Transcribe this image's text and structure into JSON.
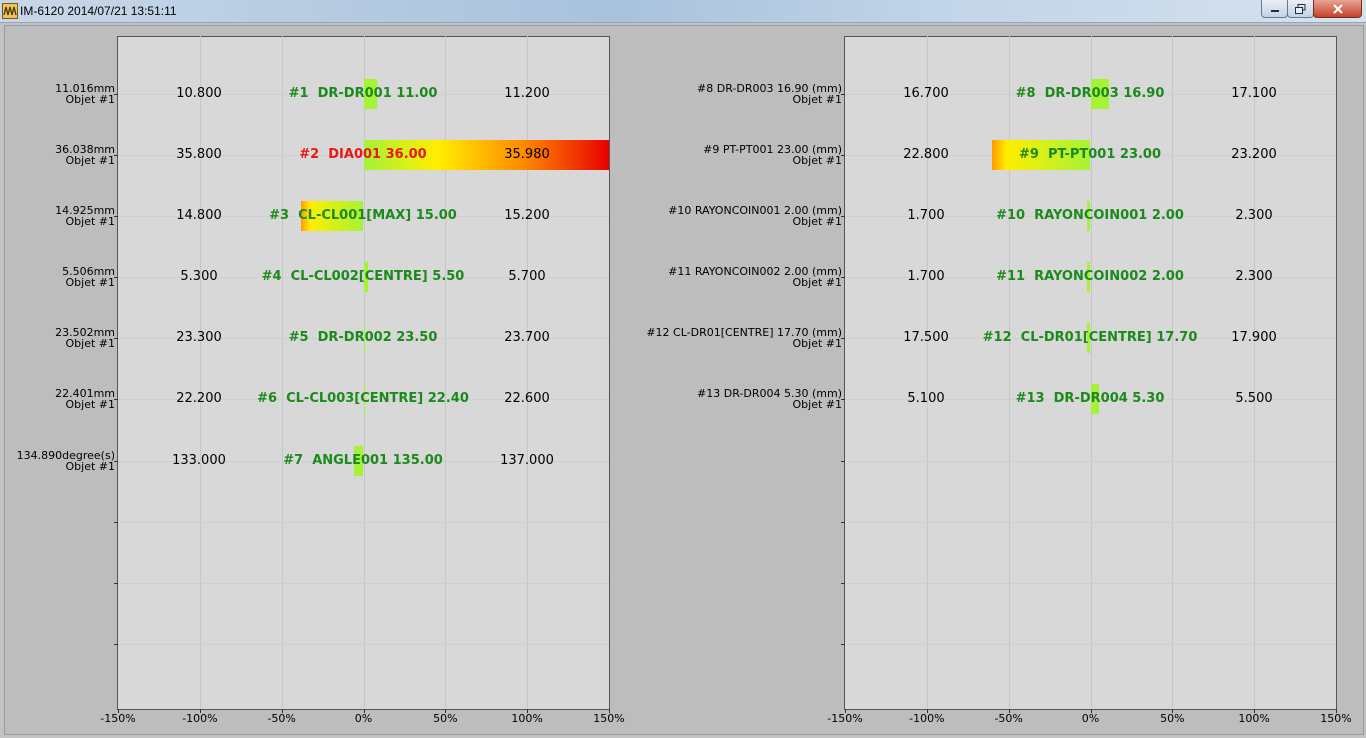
{
  "window": {
    "title": "IM-6120 2014/07/21 13:51:11",
    "app_icon": "waveform-icon",
    "controls": [
      "minimize-icon",
      "maximize-icon",
      "close-icon"
    ]
  },
  "colors": {
    "ok": "#1a8a1a",
    "ng": "#e81818",
    "bar_green": "#a6f237",
    "bar_yellow": "#ffee00",
    "bar_red": "#e80000",
    "panel_bg": "#d8d8d8"
  },
  "axis_labels": [
    "-150%",
    "-100%",
    "-50%",
    "0%",
    "50%",
    "100%",
    "150%"
  ],
  "left_panel": {
    "rows": [
      {
        "value": "11.016mm",
        "sub": "Objet #1",
        "min": "10.800",
        "name": "#1  DR-DR001 11.00",
        "max": "11.200",
        "deviation_pct": 8,
        "ng": false
      },
      {
        "value": "36.038mm",
        "sub": "Objet #1",
        "min": "35.800",
        "name": "#2  DIA001 36.00",
        "max": "35.980",
        "deviation_pct": 150,
        "ng": true
      },
      {
        "value": "14.925mm",
        "sub": "Objet #1",
        "min": "14.800",
        "name": "#3  CL-CL001[MAX] 15.00",
        "max": "15.200",
        "deviation_pct": -38,
        "ng": false
      },
      {
        "value": "5.506mm",
        "sub": "Objet #1",
        "min": "5.300",
        "name": "#4  CL-CL002[CENTRE] 5.50",
        "max": "5.700",
        "deviation_pct": 3,
        "ng": false
      },
      {
        "value": "23.502mm",
        "sub": "Objet #1",
        "min": "23.300",
        "name": "#5  DR-DR002 23.50",
        "max": "23.700",
        "deviation_pct": 1,
        "ng": false
      },
      {
        "value": "22.401mm",
        "sub": "Objet #1",
        "min": "22.200",
        "name": "#6  CL-CL003[CENTRE] 22.40",
        "max": "22.600",
        "deviation_pct": 0.5,
        "ng": false
      },
      {
        "value": "134.890degree(s)",
        "sub": "Objet #1",
        "min": "133.000",
        "name": "#7  ANGLE001 135.00",
        "max": "137.000",
        "deviation_pct": -6,
        "ng": false
      }
    ]
  },
  "right_panel": {
    "rows": [
      {
        "value": "#8  DR-DR003 16.90 (mm)",
        "sub": "Objet #1",
        "min": "16.700",
        "name": "#8  DR-DR003 16.90",
        "max": "17.100",
        "deviation_pct": 11,
        "ng": false
      },
      {
        "value": "#9  PT-PT001 23.00 (mm)",
        "sub": "Objet #1",
        "min": "22.800",
        "name": "#9  PT-PT001 23.00",
        "max": "23.200",
        "deviation_pct": -60,
        "ng": false
      },
      {
        "value": "#10  RAYONCOIN001 2.00 (mm)",
        "sub": "Objet #1",
        "min": "1.700",
        "name": "#10  RAYONCOIN001 2.00",
        "max": "2.300",
        "deviation_pct": -2,
        "ng": false
      },
      {
        "value": "#11  RAYONCOIN002 2.00 (mm)",
        "sub": "Objet #1",
        "min": "1.700",
        "name": "#11  RAYONCOIN002 2.00",
        "max": "2.300",
        "deviation_pct": -2,
        "ng": false
      },
      {
        "value": "#12  CL-DR01[CENTRE] 17.70 (mm)",
        "sub": "Objet #1",
        "min": "17.500",
        "name": "#12  CL-DR01[CENTRE] 17.70",
        "max": "17.900",
        "deviation_pct": -2,
        "ng": false
      },
      {
        "value": "#13  DR-DR004 5.30 (mm)",
        "sub": "Objet #1",
        "min": "5.100",
        "name": "#13  DR-DR004 5.30",
        "max": "5.500",
        "deviation_pct": 5,
        "ng": false
      }
    ]
  }
}
